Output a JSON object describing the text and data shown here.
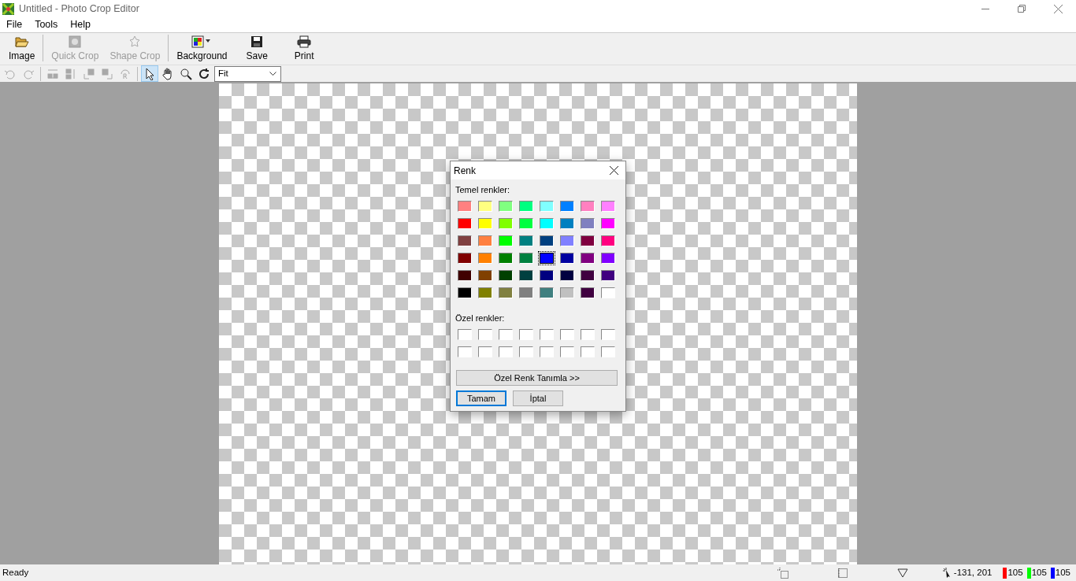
{
  "window": {
    "title": "Untitled - Photo Crop Editor"
  },
  "menu": [
    "File",
    "Tools",
    "Help"
  ],
  "toolbar": [
    {
      "kind": "open",
      "label": "Image",
      "disabled": false
    },
    {
      "kind": "quickcrop",
      "label": "Quick Crop",
      "disabled": true
    },
    {
      "kind": "shapecrop",
      "label": "Shape Crop",
      "disabled": true
    },
    {
      "kind": "background",
      "label": "Background",
      "disabled": false
    },
    {
      "kind": "save",
      "label": "Save",
      "disabled": false
    },
    {
      "kind": "print",
      "label": "Print",
      "disabled": false
    }
  ],
  "tools": [
    {
      "kind": "undo",
      "disabled": true,
      "selected": false
    },
    {
      "kind": "redo",
      "disabled": true,
      "selected": false
    },
    {
      "kind": "fliph",
      "disabled": true,
      "selected": false
    },
    {
      "kind": "flipv",
      "disabled": true,
      "selected": false
    },
    {
      "kind": "rotl",
      "disabled": true,
      "selected": false
    },
    {
      "kind": "rotr",
      "disabled": true,
      "selected": false
    },
    {
      "kind": "reset",
      "disabled": true,
      "selected": false
    },
    {
      "kind": "pointer",
      "disabled": false,
      "selected": true
    },
    {
      "kind": "hand",
      "disabled": false,
      "selected": false
    },
    {
      "kind": "zoom",
      "disabled": false,
      "selected": false
    },
    {
      "kind": "refresh",
      "disabled": false,
      "selected": false
    }
  ],
  "zoom_select": {
    "value": "Fit"
  },
  "dialog": {
    "title": "Renk",
    "basic_label": "Temel renkler:",
    "basic_colors": [
      {
        "color": "#ff8080",
        "selected": false
      },
      {
        "color": "#ffff80",
        "selected": false
      },
      {
        "color": "#80ff80",
        "selected": false
      },
      {
        "color": "#00ff80",
        "selected": false
      },
      {
        "color": "#80ffff",
        "selected": false
      },
      {
        "color": "#0080ff",
        "selected": false
      },
      {
        "color": "#ff80c0",
        "selected": false
      },
      {
        "color": "#ff80ff",
        "selected": false
      },
      {
        "color": "#ff0000",
        "selected": false
      },
      {
        "color": "#ffff00",
        "selected": false
      },
      {
        "color": "#80ff00",
        "selected": false
      },
      {
        "color": "#00ff40",
        "selected": false
      },
      {
        "color": "#00ffff",
        "selected": false
      },
      {
        "color": "#0080c0",
        "selected": false
      },
      {
        "color": "#8080c0",
        "selected": false
      },
      {
        "color": "#ff00ff",
        "selected": false
      },
      {
        "color": "#804040",
        "selected": false
      },
      {
        "color": "#ff8040",
        "selected": false
      },
      {
        "color": "#00ff00",
        "selected": false
      },
      {
        "color": "#008080",
        "selected": false
      },
      {
        "color": "#004080",
        "selected": false
      },
      {
        "color": "#8080ff",
        "selected": false
      },
      {
        "color": "#800040",
        "selected": false
      },
      {
        "color": "#ff0080",
        "selected": false
      },
      {
        "color": "#800000",
        "selected": false
      },
      {
        "color": "#ff8000",
        "selected": false
      },
      {
        "color": "#008000",
        "selected": false
      },
      {
        "color": "#008040",
        "selected": false
      },
      {
        "color": "#0000ff",
        "selected": true
      },
      {
        "color": "#0000a0",
        "selected": false
      },
      {
        "color": "#800080",
        "selected": false
      },
      {
        "color": "#8000ff",
        "selected": false
      },
      {
        "color": "#400000",
        "selected": false
      },
      {
        "color": "#804000",
        "selected": false
      },
      {
        "color": "#004000",
        "selected": false
      },
      {
        "color": "#004040",
        "selected": false
      },
      {
        "color": "#000080",
        "selected": false
      },
      {
        "color": "#000040",
        "selected": false
      },
      {
        "color": "#400040",
        "selected": false
      },
      {
        "color": "#400080",
        "selected": false
      },
      {
        "color": "#000000",
        "selected": false
      },
      {
        "color": "#808000",
        "selected": false
      },
      {
        "color": "#808040",
        "selected": false
      },
      {
        "color": "#808080",
        "selected": false
      },
      {
        "color": "#408080",
        "selected": false
      },
      {
        "color": "#c0c0c0",
        "selected": false
      },
      {
        "color": "#400040",
        "selected": false
      },
      {
        "color": "#ffffff",
        "selected": false
      }
    ],
    "custom_label": "Özel renkler:",
    "custom_colors": [
      {
        "color": "#ffffff"
      },
      {
        "color": "#ffffff"
      },
      {
        "color": "#ffffff"
      },
      {
        "color": "#ffffff"
      },
      {
        "color": "#ffffff"
      },
      {
        "color": "#ffffff"
      },
      {
        "color": "#ffffff"
      },
      {
        "color": "#ffffff"
      },
      {
        "color": "#ffffff"
      },
      {
        "color": "#ffffff"
      },
      {
        "color": "#ffffff"
      },
      {
        "color": "#ffffff"
      },
      {
        "color": "#ffffff"
      },
      {
        "color": "#ffffff"
      },
      {
        "color": "#ffffff"
      },
      {
        "color": "#ffffff"
      }
    ],
    "define_button": "Özel Renk Tanımla >>",
    "ok_button": "Tamam",
    "cancel_button": "İptal"
  },
  "status_bar": {
    "text": "Ready",
    "coordinates": "-131, 201",
    "channels": [
      {
        "value": "105",
        "color": "#ff0000"
      },
      {
        "value": "105",
        "color": "#00ff00"
      },
      {
        "value": "105",
        "color": "#0000ff"
      }
    ]
  }
}
